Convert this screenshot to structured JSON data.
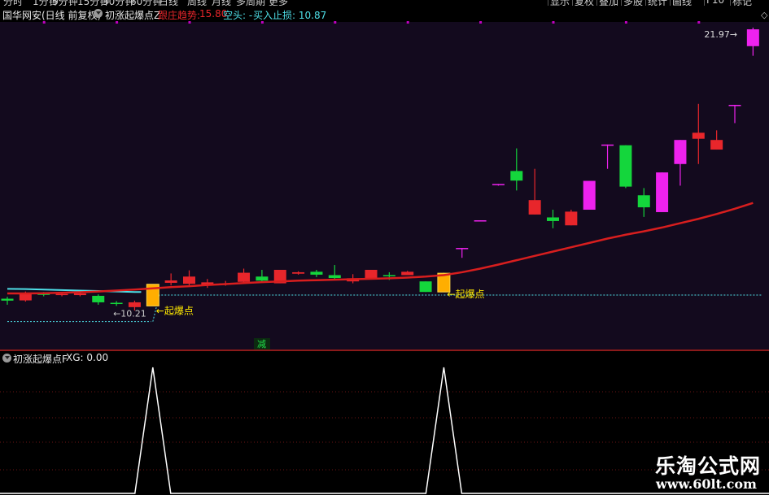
{
  "topbar": {
    "items": [
      "分时",
      "1分钟",
      "5分钟",
      "15分钟",
      "30分钟",
      "60分钟",
      "日线",
      "周线",
      "月线",
      "多周期",
      "更多",
      "显示",
      "复权",
      "叠加",
      "多股",
      "统计",
      "画线",
      "F10",
      "标记"
    ]
  },
  "main_title": {
    "stock": "国华网安(日线 前复权)",
    "indicator": "初涨起爆点Z",
    "zhuang_label": "跟庄趋势:",
    "zhuang_value": "15.80",
    "kongtou": "空头: -",
    "buy_stop": "买入止损: 10.87"
  },
  "chart_labels": {
    "high": "21.97",
    "low": "10.21",
    "signal1": "起爆点",
    "signal2": "起爆点",
    "jian": "减"
  },
  "sub_title": {
    "indicator": "初涨起爆点F",
    "xg": "XG: 0.00"
  },
  "watermark": {
    "cn": "乐淘公式网",
    "url": "www.60lt.com"
  },
  "colors": {
    "up": "#e8262b",
    "down": "#14d63c",
    "magenta": "#ee22ee",
    "signal": "#ffb800",
    "trend": "#d81e1e",
    "cyan": "#4fe0e8",
    "xg": "#ffffff"
  },
  "chart_data": {
    "type": "candlestick",
    "ylim": [
      10.21,
      21.97
    ],
    "candles": [
      {
        "o": 10.7,
        "c": 10.62,
        "h": 10.78,
        "l": 10.45,
        "color": "down"
      },
      {
        "o": 10.63,
        "c": 10.95,
        "h": 11.0,
        "l": 10.58,
        "color": "up"
      },
      {
        "o": 10.92,
        "c": 10.86,
        "h": 10.98,
        "l": 10.8,
        "color": "down"
      },
      {
        "o": 10.86,
        "c": 10.9,
        "h": 10.98,
        "l": 10.8,
        "color": "up"
      },
      {
        "o": 10.92,
        "c": 10.85,
        "h": 10.95,
        "l": 10.8,
        "color": "up"
      },
      {
        "o": 10.82,
        "c": 10.55,
        "h": 10.88,
        "l": 10.45,
        "color": "down"
      },
      {
        "o": 10.53,
        "c": 10.48,
        "h": 10.6,
        "l": 10.4,
        "color": "down"
      },
      {
        "o": 10.55,
        "c": 10.35,
        "h": 10.62,
        "l": 10.21,
        "color": "up"
      },
      {
        "o": 10.4,
        "c": 11.3,
        "h": 11.3,
        "l": 10.4,
        "color": "signal"
      },
      {
        "o": 11.36,
        "c": 11.46,
        "h": 11.75,
        "l": 11.25,
        "color": "up"
      },
      {
        "o": 11.32,
        "c": 11.62,
        "h": 11.88,
        "l": 11.25,
        "color": "up"
      },
      {
        "o": 11.38,
        "c": 11.24,
        "h": 11.52,
        "l": 11.15,
        "color": "up"
      },
      {
        "o": 11.3,
        "c": 11.34,
        "h": 11.44,
        "l": 11.24,
        "color": "up"
      },
      {
        "o": 11.4,
        "c": 11.78,
        "h": 11.95,
        "l": 11.34,
        "color": "up"
      },
      {
        "o": 11.62,
        "c": 11.45,
        "h": 11.9,
        "l": 11.38,
        "color": "down"
      },
      {
        "o": 11.34,
        "c": 11.9,
        "h": 11.9,
        "l": 11.34,
        "color": "up"
      },
      {
        "o": 11.74,
        "c": 11.8,
        "h": 11.84,
        "l": 11.7,
        "color": "up"
      },
      {
        "o": 11.7,
        "c": 11.82,
        "h": 11.9,
        "l": 11.6,
        "color": "down"
      },
      {
        "o": 11.56,
        "c": 11.68,
        "h": 12.1,
        "l": 11.5,
        "color": "down"
      },
      {
        "o": 11.42,
        "c": 11.55,
        "h": 11.72,
        "l": 11.34,
        "color": "up"
      },
      {
        "o": 11.56,
        "c": 11.9,
        "h": 11.9,
        "l": 11.56,
        "color": "up"
      },
      {
        "o": 11.68,
        "c": 11.66,
        "h": 11.8,
        "l": 11.48,
        "color": "down"
      },
      {
        "o": 11.68,
        "c": 11.82,
        "h": 11.86,
        "l": 11.68,
        "color": "up"
      },
      {
        "o": 11.42,
        "c": 10.98,
        "h": 11.42,
        "l": 10.98,
        "color": "down"
      },
      {
        "o": 10.98,
        "c": 11.76,
        "h": 11.78,
        "l": 10.98,
        "color": "signal"
      },
      {
        "o": 12.8,
        "c": 12.81,
        "h": 12.81,
        "l": 12.4,
        "color": "magenta"
      },
      {
        "o": 13.95,
        "c": 13.96,
        "h": 13.96,
        "l": 13.92,
        "color": "magenta"
      },
      {
        "o": 15.46,
        "c": 15.47,
        "h": 15.47,
        "l": 15.4,
        "color": "magenta"
      },
      {
        "o": 16.01,
        "c": 15.61,
        "h": 16.95,
        "l": 15.2,
        "color": "down"
      },
      {
        "o": 14.8,
        "c": 14.2,
        "h": 16.1,
        "l": 14.2,
        "color": "up"
      },
      {
        "o": 14.08,
        "c": 13.93,
        "h": 14.4,
        "l": 13.63,
        "color": "down"
      },
      {
        "o": 13.75,
        "c": 14.32,
        "h": 14.4,
        "l": 13.75,
        "color": "up"
      },
      {
        "o": 14.4,
        "c": 15.6,
        "h": 15.6,
        "l": 14.4,
        "color": "magenta"
      },
      {
        "o": 17.1,
        "c": 17.11,
        "h": 17.11,
        "l": 16.1,
        "color": "magenta"
      },
      {
        "o": 17.08,
        "c": 15.36,
        "h": 17.08,
        "l": 15.3,
        "color": "down"
      },
      {
        "o": 15.0,
        "c": 14.5,
        "h": 15.3,
        "l": 14.1,
        "color": "down"
      },
      {
        "o": 14.3,
        "c": 15.95,
        "h": 15.95,
        "l": 14.3,
        "color": "magenta"
      },
      {
        "o": 16.3,
        "c": 17.3,
        "h": 17.3,
        "l": 15.4,
        "color": "magenta"
      },
      {
        "o": 17.35,
        "c": 17.6,
        "h": 18.8,
        "l": 16.3,
        "color": "up"
      },
      {
        "o": 16.9,
        "c": 17.3,
        "h": 17.7,
        "l": 16.9,
        "color": "up"
      },
      {
        "o": 18.75,
        "c": 18.76,
        "h": 18.76,
        "l": 18.0,
        "color": "magenta"
      },
      {
        "o": 21.2,
        "c": 21.9,
        "h": 21.97,
        "l": 20.8,
        "color": "magenta"
      }
    ],
    "trend_line": [
      10.92,
      10.92,
      10.93,
      10.95,
      10.97,
      11.0,
      11.04,
      11.08,
      11.13,
      11.18,
      11.22,
      11.27,
      11.31,
      11.35,
      11.39,
      11.42,
      11.45,
      11.47,
      11.49,
      11.51,
      11.53,
      11.55,
      11.58,
      11.62,
      11.68,
      11.8,
      11.95,
      12.12,
      12.3,
      12.48,
      12.66,
      12.84,
      13.02,
      13.2,
      13.36,
      13.5,
      13.66,
      13.84,
      14.02,
      14.22,
      14.44,
      14.68
    ],
    "cyan_line": [
      11.11,
      11.1,
      11.08,
      11.06,
      11.04,
      11.02,
      11.0,
      10.98
    ],
    "stop_line": [
      {
        "from": 0,
        "to": 7,
        "value": 9.75
      },
      {
        "from": 8,
        "to": 23,
        "value": 10.85
      },
      {
        "from": 24,
        "to": 41,
        "value": 10.85
      }
    ],
    "signals": [
      8,
      24
    ],
    "sub_series": {
      "name": "XG",
      "peaks": [
        8,
        24
      ],
      "max": 1,
      "min": 0
    }
  }
}
